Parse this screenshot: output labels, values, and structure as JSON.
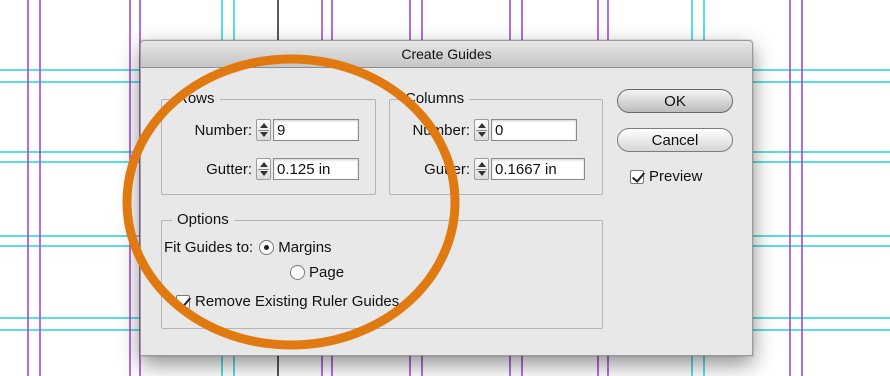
{
  "dialog": {
    "title": "Create Guides"
  },
  "rows": {
    "legend": "Rows",
    "number_label": "Number:",
    "number_value": "9",
    "gutter_label": "Gutter:",
    "gutter_value": "0.125 in"
  },
  "columns": {
    "legend": "Columns",
    "number_label": "Number:",
    "number_value": "0",
    "gutter_label": "Gutter:",
    "gutter_value": "0.1667 in"
  },
  "options": {
    "legend": "Options",
    "fit_label": "Fit Guides to:",
    "fit_options": [
      "Margins",
      "Page"
    ],
    "fit_selected": "Margins",
    "remove_existing_label": "Remove Existing Ruler Guides",
    "remove_existing_checked": true
  },
  "buttons": {
    "ok": "OK",
    "cancel": "Cancel"
  },
  "preview": {
    "label": "Preview",
    "checked": true
  },
  "colors": {
    "annotation_circle": "#e07a10",
    "guide_horizontal": "#22d3dc",
    "guide_vertical": "#9b3fd6",
    "guide_vertical_cyan": "#22d3dc",
    "dialog_bg": "#e8e8e8"
  }
}
